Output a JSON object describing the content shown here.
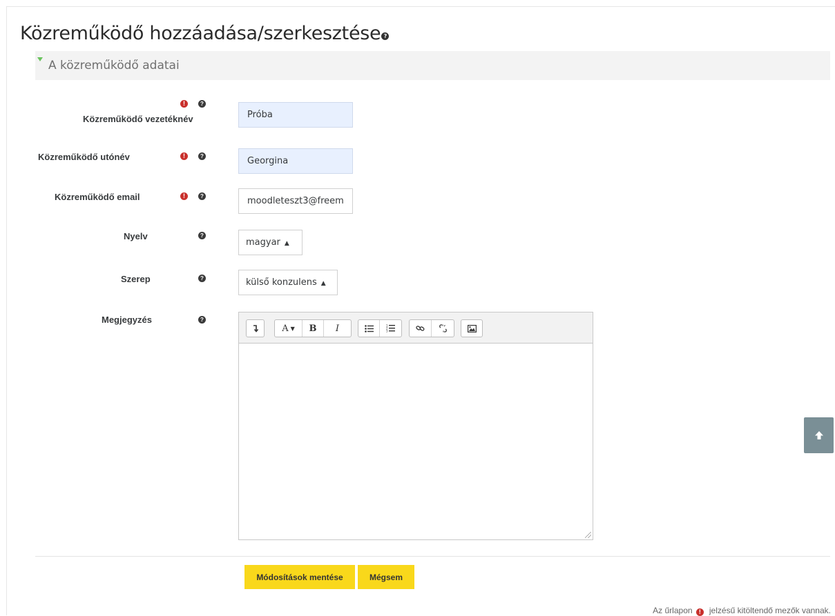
{
  "page": {
    "title": "Közreműködő hozzáadása/szerkesztése"
  },
  "section": {
    "title": "A közreműködő adatai"
  },
  "fields": {
    "lastname": {
      "label": "Közreműködő vezetéknév",
      "value": "Próba"
    },
    "firstname": {
      "label": "Közreműködő utónév",
      "value": "Georgina"
    },
    "email": {
      "label": "Közreműködő email",
      "value": "moodleteszt3@freem"
    },
    "language": {
      "label": "Nyelv",
      "selected": "magyar"
    },
    "role": {
      "label": "Szerep",
      "selected": "külső konzulens"
    },
    "note": {
      "label": "Megjegyzés",
      "value": ""
    }
  },
  "editor": {
    "toolbar": [
      "collapse-icon",
      "font-color-icon",
      "bold-icon",
      "italic-icon",
      "unordered-list-icon",
      "ordered-list-icon",
      "link-icon",
      "unlink-icon",
      "image-icon"
    ]
  },
  "buttons": {
    "save": "Módosítások mentése",
    "cancel": "Mégsem"
  },
  "footnote": {
    "before": "Az űrlapon",
    "after": "jelzésű kitöltendő mezők vannak."
  },
  "colors": {
    "button": "#f9d81b",
    "required": "#c9302c",
    "filled_input": "#e8f0fe",
    "scroll_top": "#7a8f96"
  }
}
